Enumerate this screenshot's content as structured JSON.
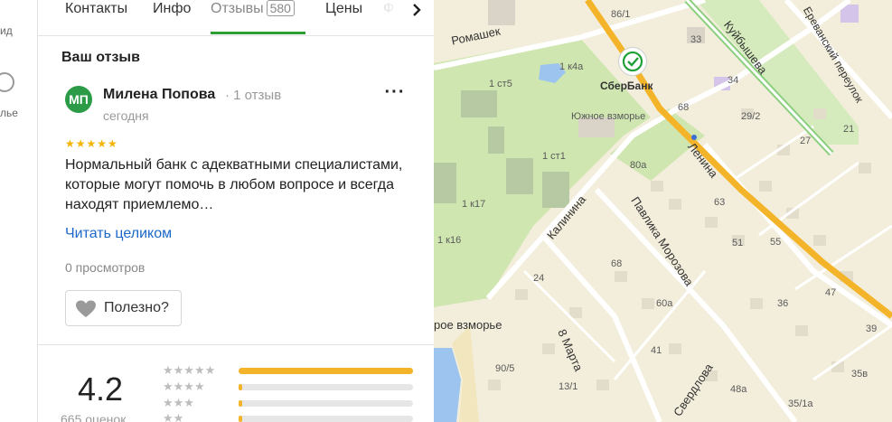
{
  "rail": {
    "item1": "ид",
    "item2": "лье"
  },
  "tabs": [
    {
      "label": "Контакты",
      "count": null
    },
    {
      "label": "Инфо",
      "count": null
    },
    {
      "label": "Отзывы",
      "count": "580"
    },
    {
      "label": "Цены",
      "count": null
    },
    {
      "label": "Ф",
      "count": null
    }
  ],
  "tabs_next_icon": "chevron-right-icon",
  "review": {
    "section_title": "Ваш отзыв",
    "avatar_initials": "МП",
    "avatar_color": "#2b9b47",
    "author": "Милена Попова",
    "author_reviews": "· 1 отзыв",
    "date": "сегодня",
    "more_label": "···",
    "stars": "★★★★★",
    "rating_stars": 5,
    "text": "Нормальный банк с адекватными специалистами, которые могут помочь в любом вопросе и всегда находят приемлемо…",
    "read_more": "Читать целиком",
    "views": "0 просмотров",
    "useful_label": "Полезно?"
  },
  "summary": {
    "rating": "4.2",
    "count_text": "665 оценок",
    "bars": [
      {
        "stars": "★★★★★",
        "fraction": 1.0
      },
      {
        "stars": "★★★★",
        "fraction": 0.02
      },
      {
        "stars": "★★★",
        "fraction": 0.02
      },
      {
        "stars": "★★",
        "fraction": 0.02
      }
    ]
  },
  "map": {
    "poi_name": "СберБанк",
    "accent_color": "#f4b42a",
    "labels": [
      "86/1",
      "33",
      "34",
      "1 к4а",
      "1 ст5",
      "68",
      "29/2",
      "Южное взморье",
      "27",
      "21",
      "1 ст1",
      "80а",
      "1 к17",
      "63",
      "55",
      "51",
      "1 к16",
      "24",
      "68",
      "60а",
      "36",
      "47",
      "39",
      "41",
      "90/5",
      "48а",
      "35в",
      "13/1",
      "35/1а",
      "рое взморье"
    ],
    "streets": [
      "Ромашек",
      "Куйбышева",
      "Ереванский переулок",
      "Ленина",
      "Калинина",
      "Павлика Морозова",
      "8 Марта",
      "Свердлова"
    ]
  }
}
